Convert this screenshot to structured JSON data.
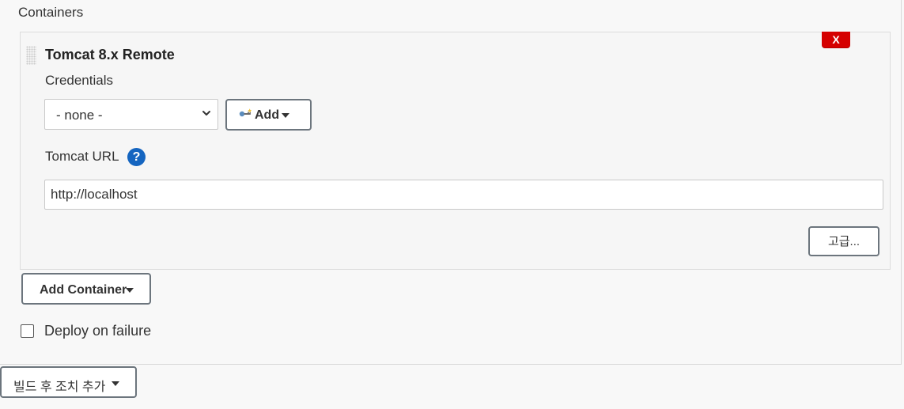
{
  "containers": {
    "section_label": "Containers",
    "items": [
      {
        "title": "Tomcat 8.x Remote",
        "delete_label": "X",
        "credentials": {
          "label": "Credentials",
          "selected": "- none -",
          "add_label": "Add"
        },
        "tomcat_url": {
          "label": "Tomcat URL",
          "value": "http://localhost",
          "help_label": "?"
        },
        "advanced_label": "고급..."
      }
    ]
  },
  "actions": {
    "add_container_label": "Add Container",
    "deploy_on_failure_label": "Deploy on failure",
    "add_post_build_label": "빌드 후 조치 추가"
  }
}
